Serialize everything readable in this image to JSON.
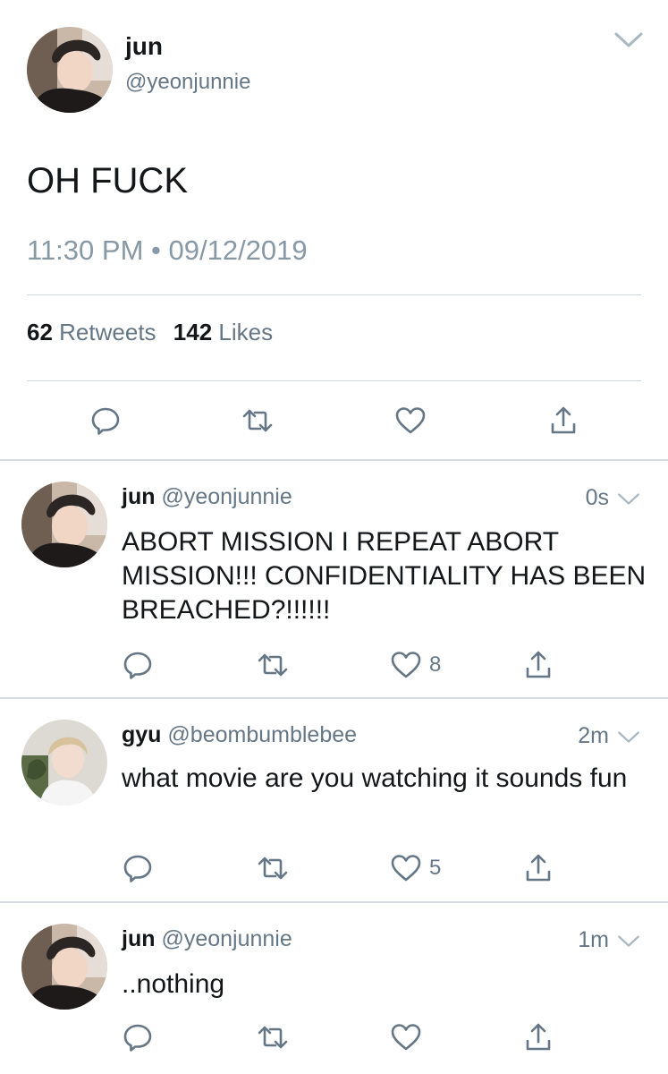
{
  "main_tweet": {
    "display_name": "jun",
    "handle": "@yeonjunnie",
    "text": "OH FUCK",
    "time": "11:30 PM",
    "separator": "•",
    "date": "09/12/2019",
    "retweets_count": "62",
    "retweets_label": "Retweets",
    "likes_count": "142",
    "likes_label": "Likes"
  },
  "replies": [
    {
      "display_name": "jun",
      "handle": "@yeonjunnie",
      "time": "0s",
      "text": "ABORT MISSION I REPEAT ABORT MISSION!!! CONFIDENTIALITY HAS BEEN BREACHED?!!!!!!",
      "like_count": "8"
    },
    {
      "display_name": "gyu",
      "handle": "@beombumblebee",
      "time": "2m",
      "text": "what movie are you watching it sounds fun",
      "like_count": "5"
    },
    {
      "display_name": "jun",
      "handle": "@yeonjunnie",
      "time": "1m",
      "text": "..nothing",
      "like_count": ""
    }
  ],
  "icons": {
    "reply": "reply-icon",
    "retweet": "retweet-icon",
    "like": "heart-icon",
    "share": "share-icon",
    "more": "chevron-down-icon"
  },
  "colors": {
    "text_primary": "#14171a",
    "text_secondary": "#657786",
    "icon": "#657786",
    "divider": "#cfd6dc"
  }
}
